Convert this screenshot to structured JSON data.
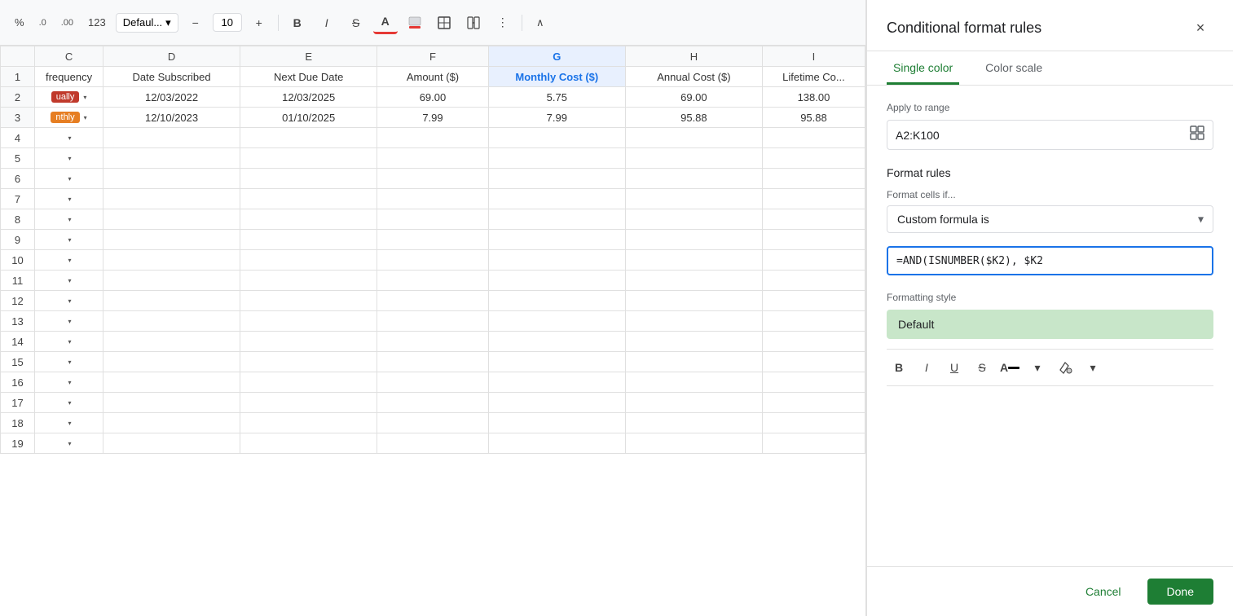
{
  "toolbar": {
    "percent_label": "%",
    "decimal_less": ".0",
    "decimal_more": ".00",
    "format_123": "123",
    "font_name": "Defaul...",
    "font_size": "10",
    "font_size_decrease": "−",
    "font_size_increase": "+",
    "bold": "B",
    "italic": "I",
    "strikethrough": "S",
    "text_color": "A",
    "fill_color": "🪣",
    "borders": "⊞",
    "merge": "⊟",
    "more": "⋮",
    "collapse": "∧"
  },
  "spreadsheet": {
    "columns": [
      "C",
      "D",
      "E",
      "F",
      "G",
      "H",
      "I"
    ],
    "col_widths": [
      "80px",
      "160px",
      "160px",
      "130px",
      "160px",
      "160px",
      "120px"
    ],
    "header_row": [
      "frequency",
      "Date Subscribed",
      "Next Due Date",
      "Amount ($)",
      "Monthly Cost ($)",
      "Annual Cost ($)",
      "Lifetime Co..."
    ],
    "rows": [
      {
        "freq_badge": "ually",
        "freq_color": "red",
        "date_sub": "12/03/2022",
        "next_due": "12/03/2025",
        "amount": "69.00",
        "monthly": "5.75",
        "annual": "69.00",
        "lifetime": "138.00"
      },
      {
        "freq_badge": "nthly",
        "freq_color": "orange",
        "date_sub": "12/10/2023",
        "next_due": "01/10/2025",
        "amount": "7.99",
        "monthly": "7.99",
        "annual": "95.88",
        "lifetime": "95.88"
      }
    ],
    "empty_rows": 16
  },
  "panel": {
    "title": "Conditional format rules",
    "close_icon": "×",
    "tabs": [
      {
        "label": "Single color",
        "active": true
      },
      {
        "label": "Color scale",
        "active": false
      }
    ],
    "apply_to_range_label": "Apply to range",
    "range_value": "A2:K100",
    "format_rules_label": "Format rules",
    "format_cells_if_label": "Format cells if...",
    "format_condition": "Custom formula is",
    "formula_value": "=AND(ISNUMBER($K2), $K2",
    "formatting_style_label": "Formatting style",
    "default_style_label": "Default",
    "format_toolbar": {
      "bold": "B",
      "italic": "I",
      "underline": "U",
      "strikethrough": "S",
      "text_color": "A",
      "fill_color": "◎"
    },
    "cancel_label": "Cancel",
    "done_label": "Done",
    "accent_color": "#1e7e34"
  }
}
